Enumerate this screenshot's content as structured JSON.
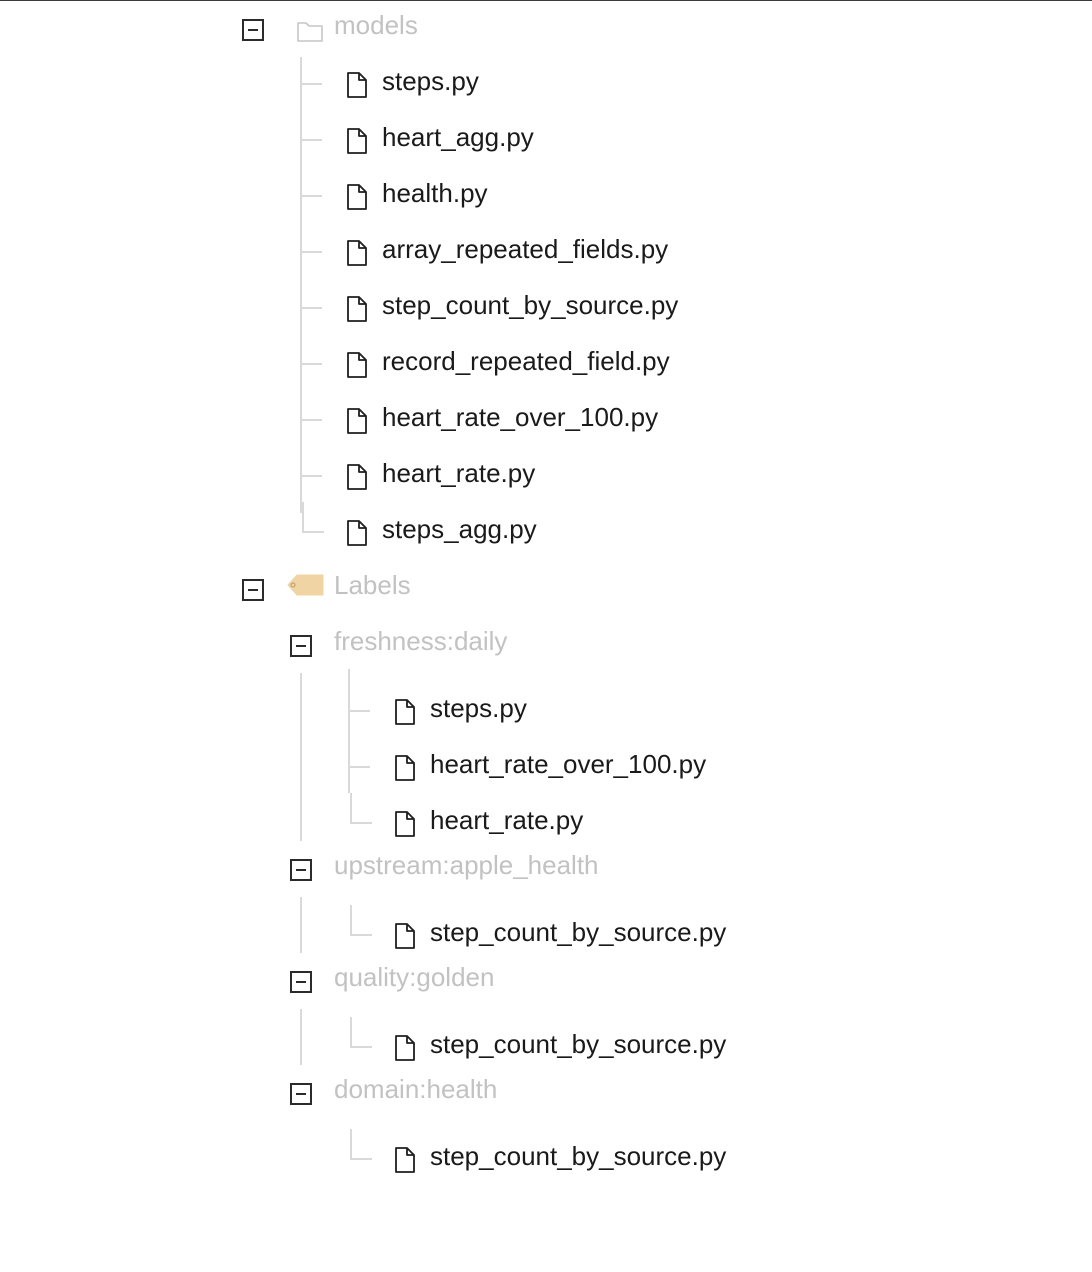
{
  "tree": {
    "models": {
      "label": "models",
      "files": [
        "steps.py",
        "heart_agg.py",
        "health.py",
        "array_repeated_fields.py",
        "step_count_by_source.py",
        "record_repeated_field.py",
        "heart_rate_over_100.py",
        "heart_rate.py",
        "steps_agg.py"
      ]
    },
    "labels": {
      "label": "Labels",
      "groups": [
        {
          "label": "freshness:daily",
          "files": [
            "steps.py",
            "heart_rate_over_100.py",
            "heart_rate.py"
          ]
        },
        {
          "label": "upstream:apple_health",
          "files": [
            "step_count_by_source.py"
          ]
        },
        {
          "label": "quality:golden",
          "files": [
            "step_count_by_source.py"
          ]
        },
        {
          "label": "domain:health",
          "files": [
            "step_count_by_source.py"
          ]
        }
      ]
    }
  },
  "icons": {
    "toggle": "collapse-minus-icon",
    "folder": "folder-icon",
    "label": "tag-icon",
    "file": "file-icon"
  },
  "colors": {
    "label_tag": "#f1d4a3",
    "group_text": "#c2c2c2",
    "file_text": "#1a1a1a",
    "tree_line": "#d9d9d9"
  }
}
